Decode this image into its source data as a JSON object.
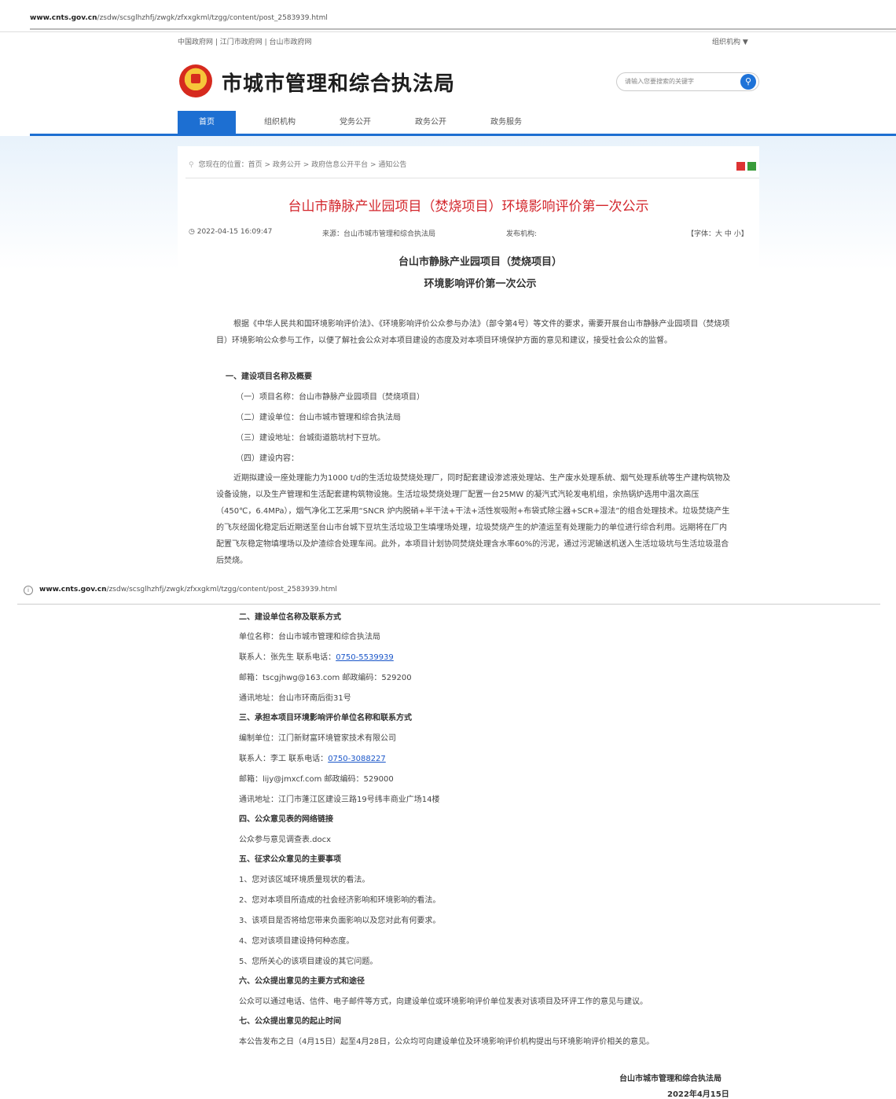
{
  "browser": {
    "url_host_1": "www.cnts.gov.cn",
    "url_path_1": "/zsdw/scsglhzhfj/zwgk/zfxxgkml/tzgg/content/post_2583939.html",
    "url_host_2": "www.cnts.gov.cn",
    "url_path_2": "/zsdw/scsglhzhfj/zwgk/zfxxgkml/tzgg/content/post_2583939.html"
  },
  "header": {
    "top_links": "中国政府网 | 江门市政府网 | 台山市政府网",
    "org_menu": "组织机构 ▼",
    "site_name": "市城市管理和综合执法局",
    "search_placeholder": "请输入您要搜索的关键字",
    "search_icon": "search-icon"
  },
  "nav": {
    "items": [
      "首页",
      "组织机构",
      "党务公开",
      "政务公开",
      "政务服务"
    ]
  },
  "breadcrumb": "您现在的位置：首页 > 政务公开 > 政府信息公开平台 > 通知公告",
  "article": {
    "title": "台山市静脉产业园项目（焚烧项目）环境影响评价第一次公示",
    "date": "2022-04-15 16:09:47",
    "source": "来源：台山市城市管理和综合执法局",
    "publisher": "发布机构:",
    "fontsize": "【字体：大 中 小】",
    "subtitle1": "台山市静脉产业园项目（焚烧项目）",
    "subtitle2": "环境影响评价第一次公示",
    "intro": "根据《中华人民共和国环境影响评价法》、《环境影响评价公众参与办法》（部令第4号）等文件的要求，需要开展台山市静脉产业园项目（焚烧项目）环境影响公众参与工作，以便了解社会公众对本项目建设的态度及对本项目环境保护方面的意见和建议，接受社会公众的监督。",
    "s1_heading": "一、建设项目名称及概要",
    "s1_items": [
      "（一）项目名称：台山市静脉产业园项目（焚烧项目）",
      "（二）建设单位：台山市城市管理和综合执法局",
      "（三）建设地址：台城街道筋坑村下豆坑。",
      "（四）建设内容："
    ],
    "s1_content": "近期拟建设一座处理能力为1000 t/d的生活垃圾焚烧处理厂，同时配套建设渗滤液处理站、生产废水处理系统、烟气处理系统等生产建构筑物及设备设施，以及生产管理和生活配套建构筑物设施。生活垃圾焚烧处理厂配置一台25MW 的凝汽式汽轮发电机组，余热锅炉选用中温次高压（450℃，6.4MPa），烟气净化工艺采用“SNCR 炉内脱硝+半干法+干法+活性炭吸附+布袋式除尘器+SCR+湿法”的组合处理技术。垃圾焚烧产生的飞灰经固化稳定后近期送至台山市台城下豆坑生活垃圾卫生填埋场处理，垃圾焚烧产生的炉渣运至有处理能力的单位进行综合利用。远期将在厂内配置飞灰稳定物填埋场以及炉渣综合处理车间。此外，本项目计划协同焚烧处理含水率60%的污泥，通过污泥输送机送入生活垃圾坑与生活垃圾混合后焚烧。",
    "s2_heading": "二、建设单位名称及联系方式",
    "s2_unit": "单位名称：台山市城市管理和综合执法局",
    "s2_contact": "联系人：张先生  联系电话：",
    "s2_phone": "0750-5539939",
    "s2_mail": "邮箱：tscgjhwg@163.com  邮政编码：529200",
    "s2_addr": "通讯地址：台山市环南后街31号",
    "s3_heading": "三、承担本项目环境影响评价单位名称和联系方式",
    "s3_unit": "编制单位：江门新财富环境管家技术有限公司",
    "s3_contact": "联系人：李工     联系电话：",
    "s3_phone": "0750-3088227",
    "s3_mail": "邮箱：lijy@jmxcf.com  邮政编码：529000",
    "s3_addr": "通讯地址：江门市蓬江区建设三路19号纬丰商业广场14楼",
    "s4_heading": "四、公众意见表的网络链接",
    "s4_file": "公众参与意见调查表.docx",
    "s5_heading": "五、征求公众意见的主要事项",
    "s5_items": [
      "1、您对该区域环境质量现状的看法。",
      "2、您对本项目所造成的社会经济影响和环境影响的看法。",
      "3、该项目是否将给您带来负面影响以及您对此有何要求。",
      "4、您对该项目建设持何种态度。",
      "5、您所关心的该项目建设的其它问题。"
    ],
    "s6_heading": "六、公众提出意见的主要方式和途径",
    "s6_text": "公众可以通过电话、信件、电子邮件等方式，向建设单位或环境影响评价单位发表对该项目及环评工作的意见与建议。",
    "s7_heading": "七、公众提出意见的起止时间",
    "s7_text": "本公告发布之日（4月15日）起至4月28日，公众均可向建设单位及环境影响评价机构提出与环境影响评价相关的意见。",
    "sign_org": "台山市城市管理和综合执法局",
    "sign_date": "2022年4月15日"
  },
  "colors": {
    "accent_blue": "#1d6fd2",
    "title_red": "#d3262c",
    "link_blue": "#1a56c9"
  }
}
